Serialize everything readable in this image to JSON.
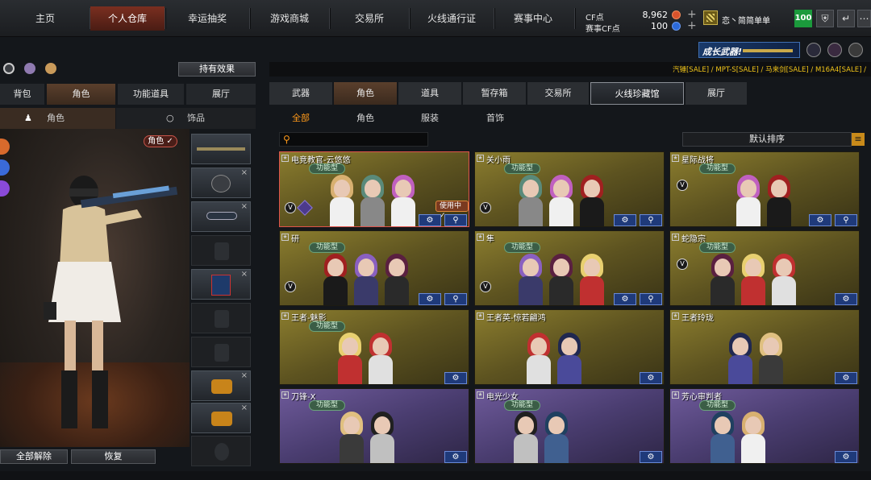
{
  "nav": {
    "tabs": [
      "主页",
      "个人仓库",
      "幸运抽奖",
      "游戏商城",
      "交易所",
      "火线通行证",
      "赛事中心"
    ],
    "active": "个人仓库"
  },
  "currency": {
    "cf_label": "CF点",
    "cf_value": "8,962",
    "event_label": "赛事CF点",
    "event_value": "100"
  },
  "user": {
    "name": "恋丶简简单单",
    "level": "100"
  },
  "banner": {
    "grow_weapon": "成长武器!"
  },
  "sale_ticker": "汽锤[SALE] / MPT-S[SALE] / 马来剑[SALE] / M16A4[SALE] /",
  "left": {
    "hold_effect": "持有效果",
    "tabs": [
      "背包",
      "角色",
      "功能道具",
      "展厅"
    ],
    "active_tab": "角色",
    "subtabs": [
      "角色",
      "饰品"
    ],
    "role_badge": "角色 ✓",
    "release_all": "全部解除",
    "restore": "恢复"
  },
  "right": {
    "tabs": [
      "武器",
      "角色",
      "道具",
      "暂存箱",
      "交易所",
      "火线珍藏馆",
      "展厅"
    ],
    "active_tab": "角色",
    "highlight_tab": "火线珍藏馆",
    "subtabs": [
      "全部",
      "角色",
      "服装",
      "首饰"
    ],
    "active_subtab": "全部",
    "sort": "默认排序"
  },
  "cards": [
    {
      "name": "电竞教官-云悠悠",
      "func": "功能型",
      "in_use": "使用中✓",
      "theme": "gold"
    },
    {
      "name": "关小雨",
      "func": "功能型",
      "theme": "gold"
    },
    {
      "name": "星际战将",
      "func": "功能型",
      "theme": "gold"
    },
    {
      "name": "研",
      "func": "功能型",
      "theme": "gold"
    },
    {
      "name": "隼",
      "func": "功能型",
      "theme": "gold"
    },
    {
      "name": "蛇隐宗",
      "func": "功能型",
      "theme": "gold"
    },
    {
      "name": "王者-魅影",
      "func": "功能型",
      "theme": "gold"
    },
    {
      "name": "王者英-惊若翩鸿",
      "theme": "gold"
    },
    {
      "name": "王者玲珑",
      "theme": "gold"
    },
    {
      "name": "刀锋-X",
      "func": "功能型",
      "theme": "purple"
    },
    {
      "name": "电光少女",
      "func": "功能型",
      "theme": "purple"
    },
    {
      "name": "芳心审判者",
      "func": "功能型",
      "theme": "purple"
    }
  ],
  "colors": {
    "accent": "#ff9a1a",
    "gold_card": "#8b7d2e",
    "purple_card": "#6e5a9a",
    "selected": "#e0544a"
  }
}
